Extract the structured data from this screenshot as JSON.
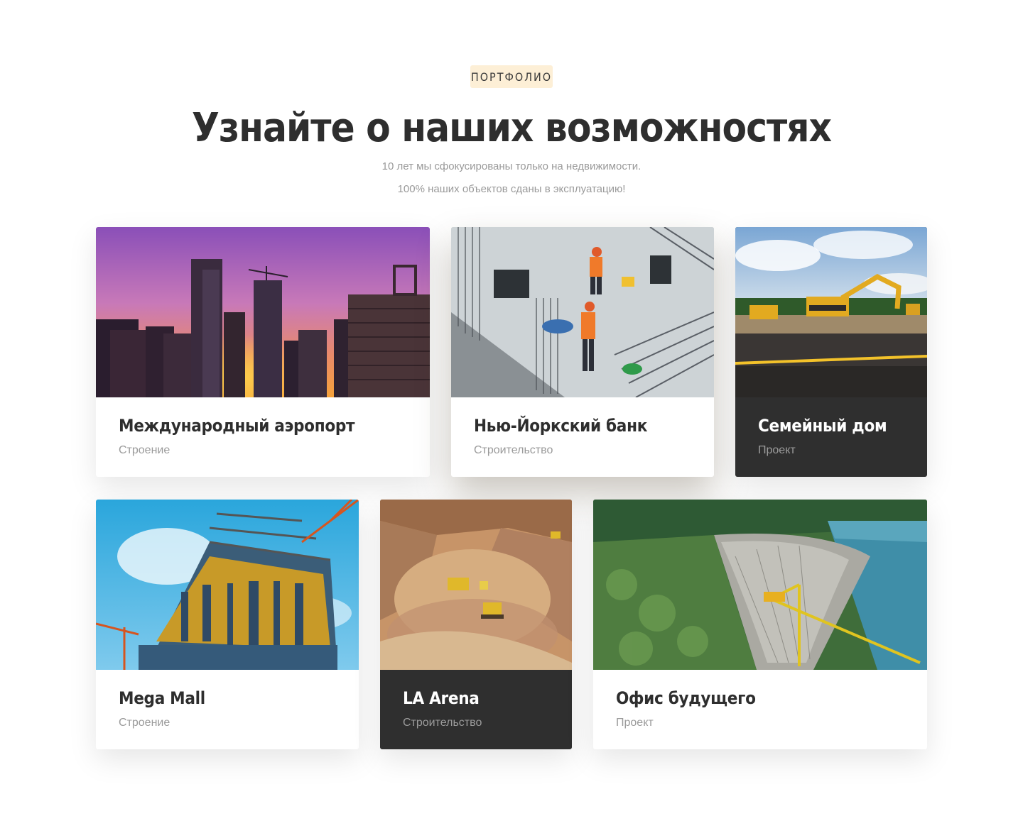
{
  "header": {
    "badge": "ПОРТФОЛИО",
    "title": "Узнайте о наших возможностях",
    "subtitle_line1": "10 лет мы сфокусированы только на недвижимости.",
    "subtitle_line2": "100% наших объектов сданы в эксплуатацию!"
  },
  "colors": {
    "badge_bg": "#fdefd6",
    "dark_card": "#2f2f2f",
    "heading": "#2e2e2e",
    "muted": "#9a9a9a"
  },
  "projects": [
    {
      "name": "Международный аэропорт",
      "category": "Строение",
      "image": "city-skyline-sunset-photo"
    },
    {
      "name": "Нью-Йоркский банк",
      "category": "Строительство",
      "image": "rebar-construction-workers-photo"
    },
    {
      "name": "Семейный дом",
      "category": "Проект",
      "image": "excavators-field-photo"
    },
    {
      "name": "Mega Mall",
      "category": "Строение",
      "image": "building-under-construction-photo"
    },
    {
      "name": "LA Arena",
      "category": "Строительство",
      "image": "quarry-bulldozers-photo"
    },
    {
      "name": "Офис будущего",
      "category": "Проект",
      "image": "dam-crane-photo"
    }
  ]
}
